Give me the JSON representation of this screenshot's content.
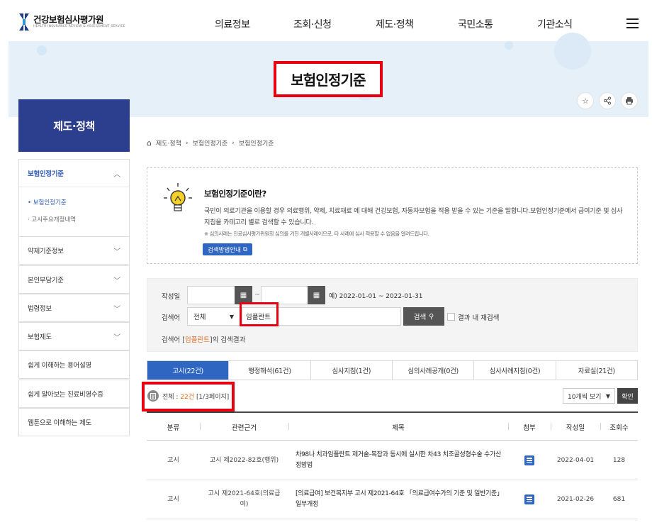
{
  "header": {
    "logo_text": "건강보험심사평가원",
    "logo_sub": "HEALTH INSURANCE REVIEW & ASSESSMENT SERVICE",
    "nav": [
      "의료정보",
      "조회·신청",
      "제도·정책",
      "국민소통",
      "기관소식"
    ]
  },
  "banner": {
    "title": "보험인정기준"
  },
  "sidebar": {
    "title": "제도·정책",
    "active_label": "보험인정기준",
    "sub_items": [
      "보험인정기준",
      "고시주요개정내역"
    ],
    "items": [
      "약제기준정보",
      "본인부담기준",
      "법령정보",
      "보험제도",
      "쉽게 이해하는 용어설명",
      "쉽게 알아보는 진료비영수증",
      "웹툰으로 이해하는 제도"
    ]
  },
  "breadcrumb": [
    "제도·정책",
    "보험인정기준",
    "보험인정기준"
  ],
  "info": {
    "title": "보험인정기준이란?",
    "desc": "국민이 의료기관을 이용할 경우 의료행위, 약제, 치료재료 에 대해 건강보험, 자동차보험을 적용 받을 수 있는 기준을 말합니다.보험인정기준에서 급여기준 및 심사지침을 카테고리 별로 검색할 수 있습니다.",
    "note": "※ 심의사례는 진료심사평가위원회 심의를 거친 개별사례이므로, 타 사례에 심사 적용할 수 없음을 알려드립니다.",
    "guide_button": "검색방법안내"
  },
  "search": {
    "date_label": "작성일",
    "date_sep": "~",
    "date_example": "예) 2022-01-01 ~ 2022-01-31",
    "keyword_label": "검색어",
    "scope_value": "전체",
    "keyword_value": "임플란트",
    "search_button": "검색",
    "research_label": "결과 내 재검색",
    "result_prefix": "검색어 [",
    "result_keyword": "임플란트",
    "result_suffix": "]의 검색결과"
  },
  "tabs": [
    "고시(22건)",
    "행정해석(61건)",
    "심사지침(1건)",
    "심의사례공개(0건)",
    "심사사례지침(0건)",
    "자료실(21건)"
  ],
  "listing": {
    "total_label": "전체 : ",
    "total_count": "22건",
    "page_info": "[1/3페이지]",
    "page_size": "10개씩 보기",
    "confirm": "확인"
  },
  "table": {
    "headers": [
      "분류",
      "관련근거",
      "제목",
      "첨부",
      "작성일",
      "조회수"
    ],
    "rows": [
      {
        "category": "고시",
        "basis": "고시 제2022-82호(행위)",
        "title": "차98나 치과임플란트 제거술-복잡과 동시에 실시한 차43 치조골성형수술 수가산정방법",
        "date": "2022-04-01",
        "views": "128"
      },
      {
        "category": "고시",
        "basis": "고시 제2021-64호(의료급여)",
        "title": "[의료급여] 보건복지부 고시 제2021-64호 「의료급여수가의 기준 및 일반기준」 일부개정",
        "date": "2021-02-26",
        "views": "681"
      }
    ]
  },
  "colors": {
    "primary": "#2c3f8f",
    "accent_blue": "#2f66c2",
    "highlight_red": "#e60012",
    "orange": "#e26a1f"
  }
}
